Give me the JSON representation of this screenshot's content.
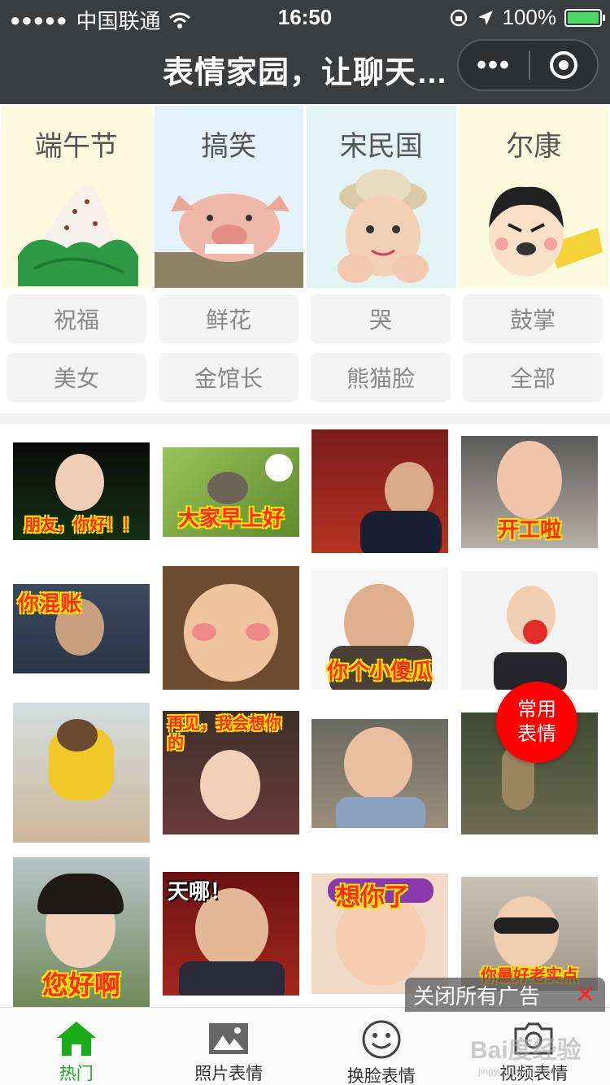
{
  "status_bar": {
    "carrier": "中国联通",
    "time": "16:50",
    "battery": "100%"
  },
  "nav": {
    "title": "表情家园，让聊天…",
    "more_glyph": "•••"
  },
  "banners": [
    {
      "label": "端午节"
    },
    {
      "label": "搞笑"
    },
    {
      "label": "宋民国"
    },
    {
      "label": "尔康"
    }
  ],
  "tags": [
    "祝福",
    "鲜花",
    "哭",
    "鼓掌",
    "美女",
    "金馆长",
    "熊猫脸",
    "全部"
  ],
  "stickers": [
    {
      "caption": "朋友，你好！！"
    },
    {
      "caption": "大家早上好"
    },
    {
      "caption": ""
    },
    {
      "caption": "开工啦"
    },
    {
      "caption": "你混账"
    },
    {
      "caption": ""
    },
    {
      "caption": "你个小傻瓜"
    },
    {
      "caption": ""
    },
    {
      "caption": ""
    },
    {
      "caption": "再见，我会想你的"
    },
    {
      "caption": ""
    },
    {
      "caption": ""
    },
    {
      "caption": "您好啊"
    },
    {
      "caption": "天哪！"
    },
    {
      "caption": "想你了"
    },
    {
      "caption": "你最好老实点"
    }
  ],
  "float_button": {
    "line1": "常用",
    "line2": "表情"
  },
  "ad_bar": {
    "text": "关闭所有广告",
    "close": "✕"
  },
  "tabbar": [
    {
      "label": "热门",
      "icon": "home-icon",
      "active": true
    },
    {
      "label": "照片表情",
      "icon": "photo-icon",
      "active": false
    },
    {
      "label": "换脸表情",
      "icon": "smiley-icon",
      "active": false
    },
    {
      "label": "视频表情",
      "icon": "camera-icon",
      "active": false
    }
  ],
  "watermark": {
    "text": "Bai度经验",
    "sub": "jingyan.baidu.com"
  },
  "colors": {
    "active_tab": "#1aad19",
    "float_button": "#ff0000",
    "nav_bg": "#3b3c3e"
  }
}
